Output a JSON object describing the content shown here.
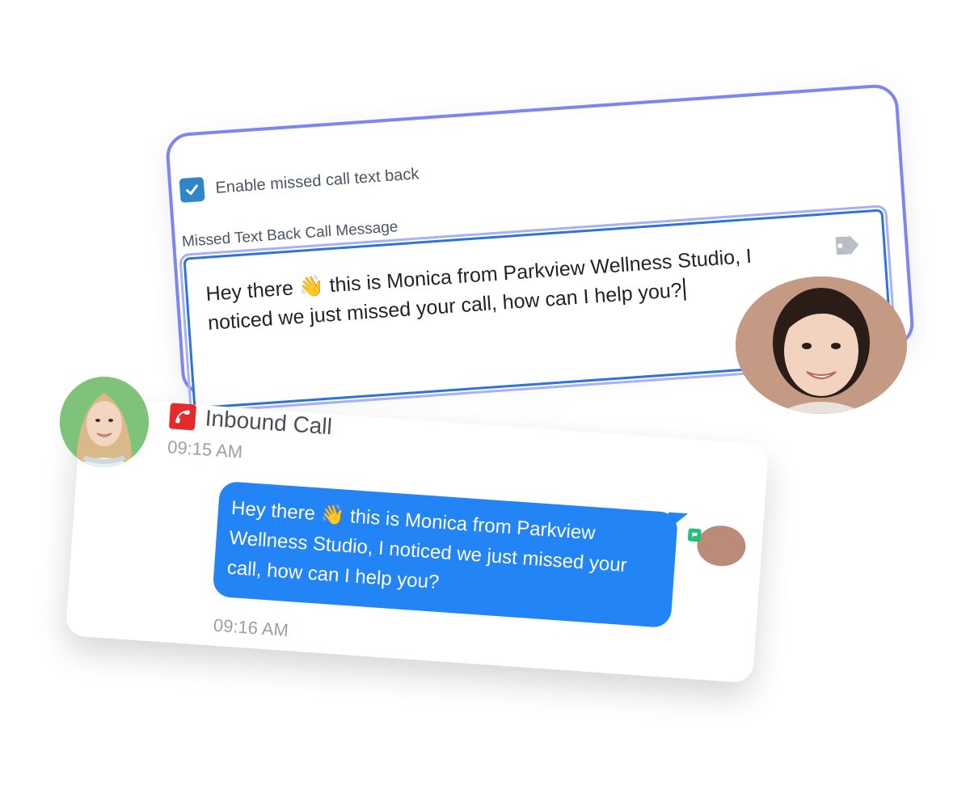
{
  "settings": {
    "enable_label": "Enable missed call text back",
    "enabled": true,
    "message_label": "Missed Text Back Call Message",
    "message_value": "Hey there 👋 this is Monica from Parkview Wellness Studio, I noticed we just missed your call, how can I help you?"
  },
  "conversation": {
    "call_title": "Inbound Call",
    "call_time": "09:15 AM",
    "message_text": "Hey there 👋 this is Monica from Parkview Wellness Studio, I noticed we just missed your call, how can I help you?",
    "message_time": "09:16 AM"
  },
  "icons": {
    "checkbox": "checkmark-icon",
    "tag": "tag-icon",
    "call": "phone-icon",
    "sms": "sms-icon"
  },
  "colors": {
    "card_border": "#7d86ef",
    "input_border": "#2f73d9",
    "checkbox": "#2f86c8",
    "bubble": "#2384f5",
    "call_icon": "#e32b2b",
    "sms_icon": "#22c07a"
  }
}
